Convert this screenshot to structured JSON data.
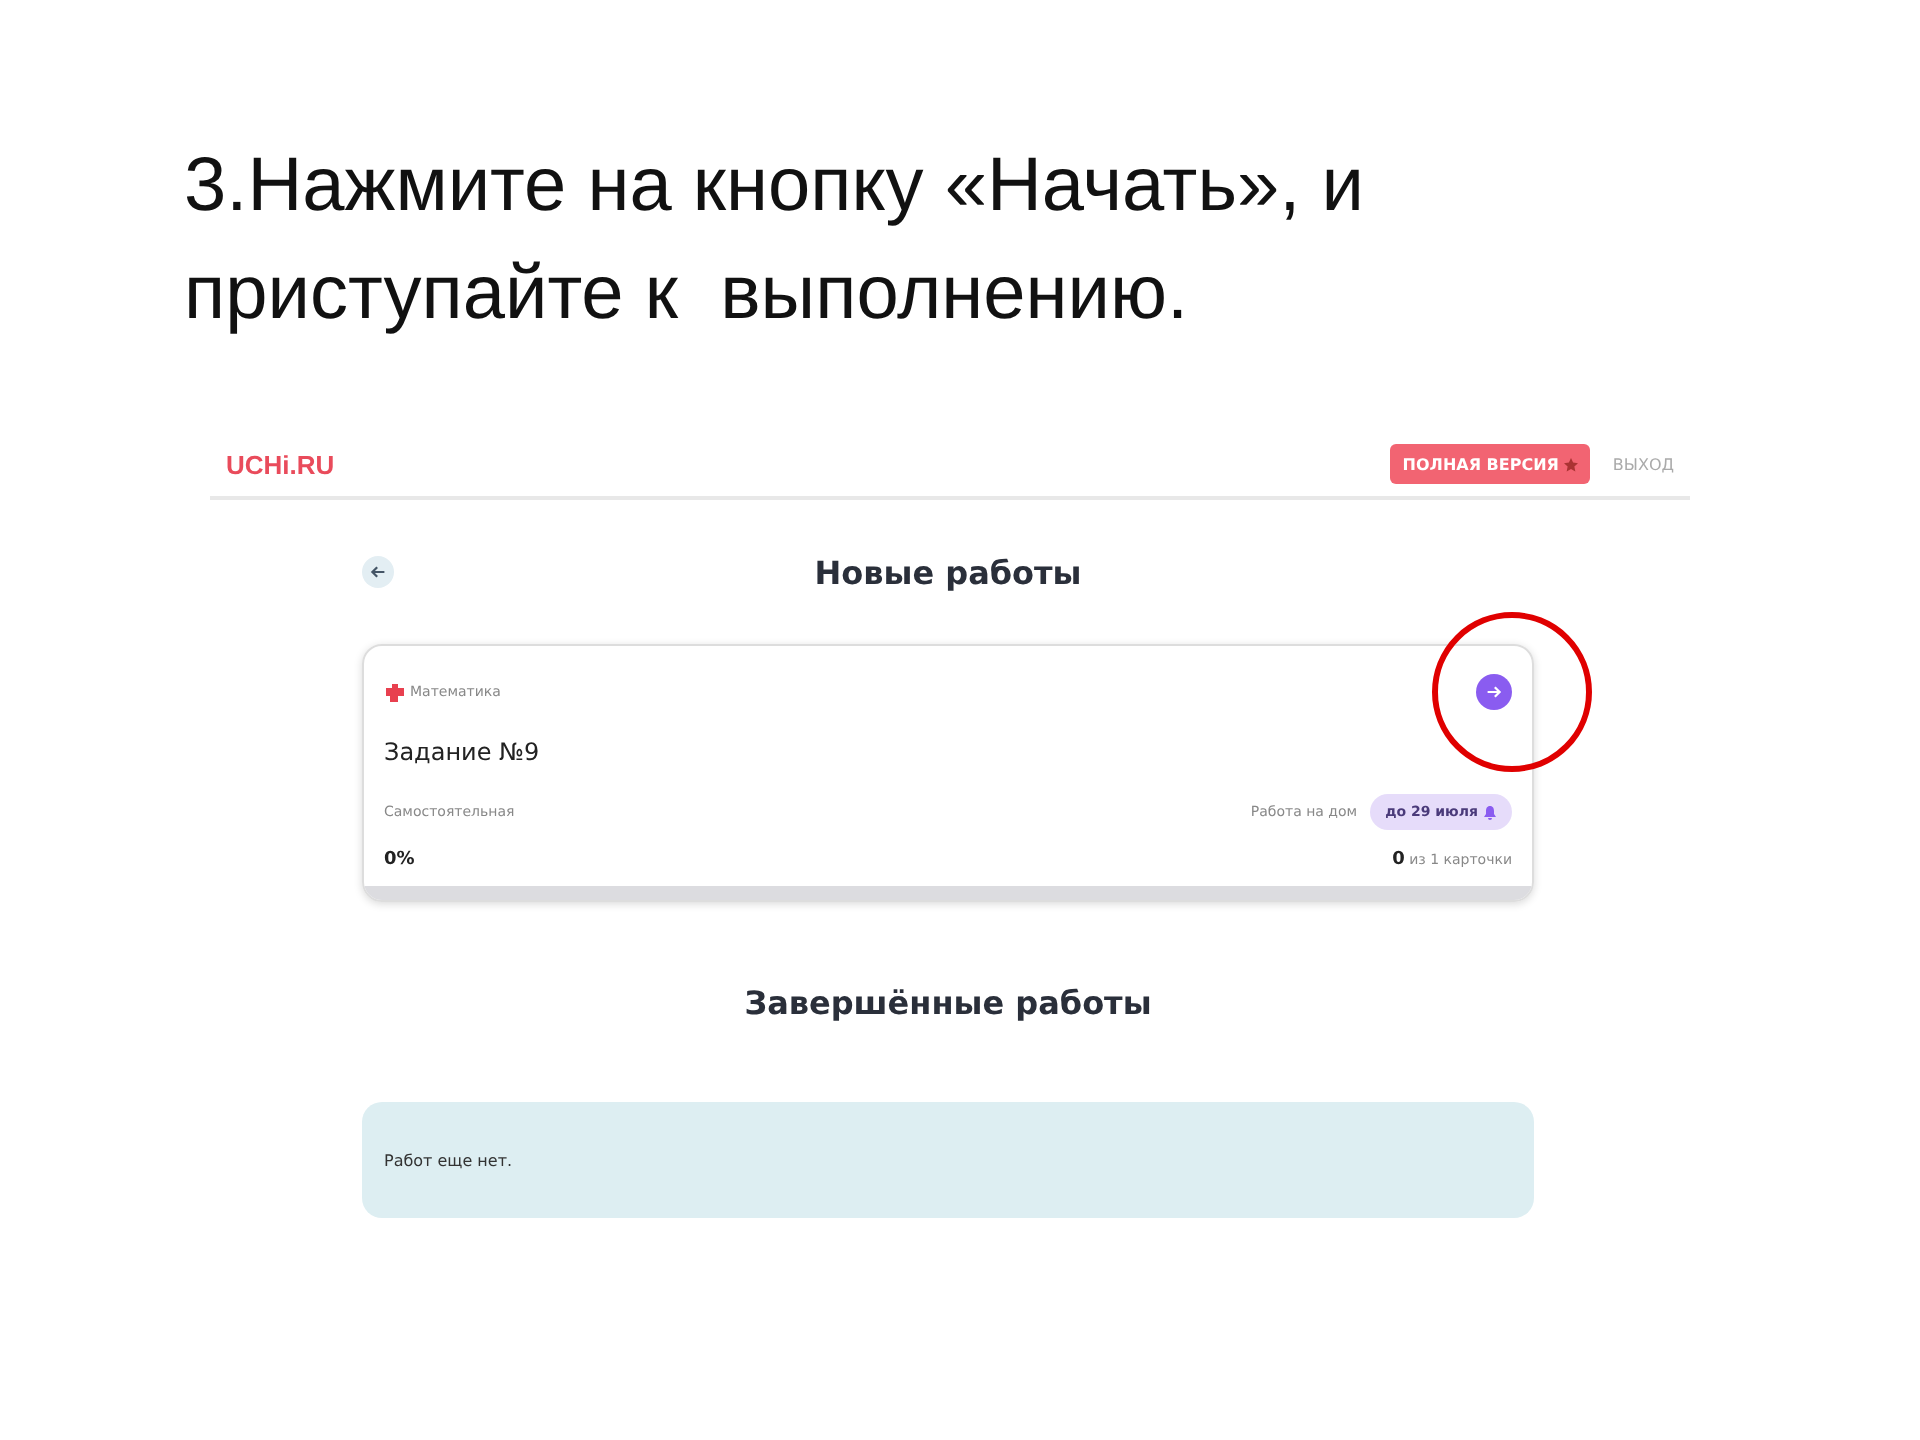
{
  "instruction": "3.Нажмите на кнопку «Начать», и\nприступайте к  выполнению.",
  "header": {
    "logo": "UCHi.RU",
    "full_version_button": "ПОЛНАЯ ВЕРСИЯ",
    "logout_link": "ВЫХОД"
  },
  "new_works": {
    "title": "Новые работы",
    "cards": [
      {
        "subject": "Математика",
        "title": "Задание №9",
        "type": "Самостоятельная",
        "category": "Работа на дом",
        "deadline": "до 29 июля",
        "percent": "0%",
        "done": "0",
        "total": "из 1 карточки",
        "level": 0,
        "highlighted": true
      }
    ]
  },
  "completed_works": {
    "title": "Завершённые работы",
    "empty_text": "Работ еще нет."
  }
}
